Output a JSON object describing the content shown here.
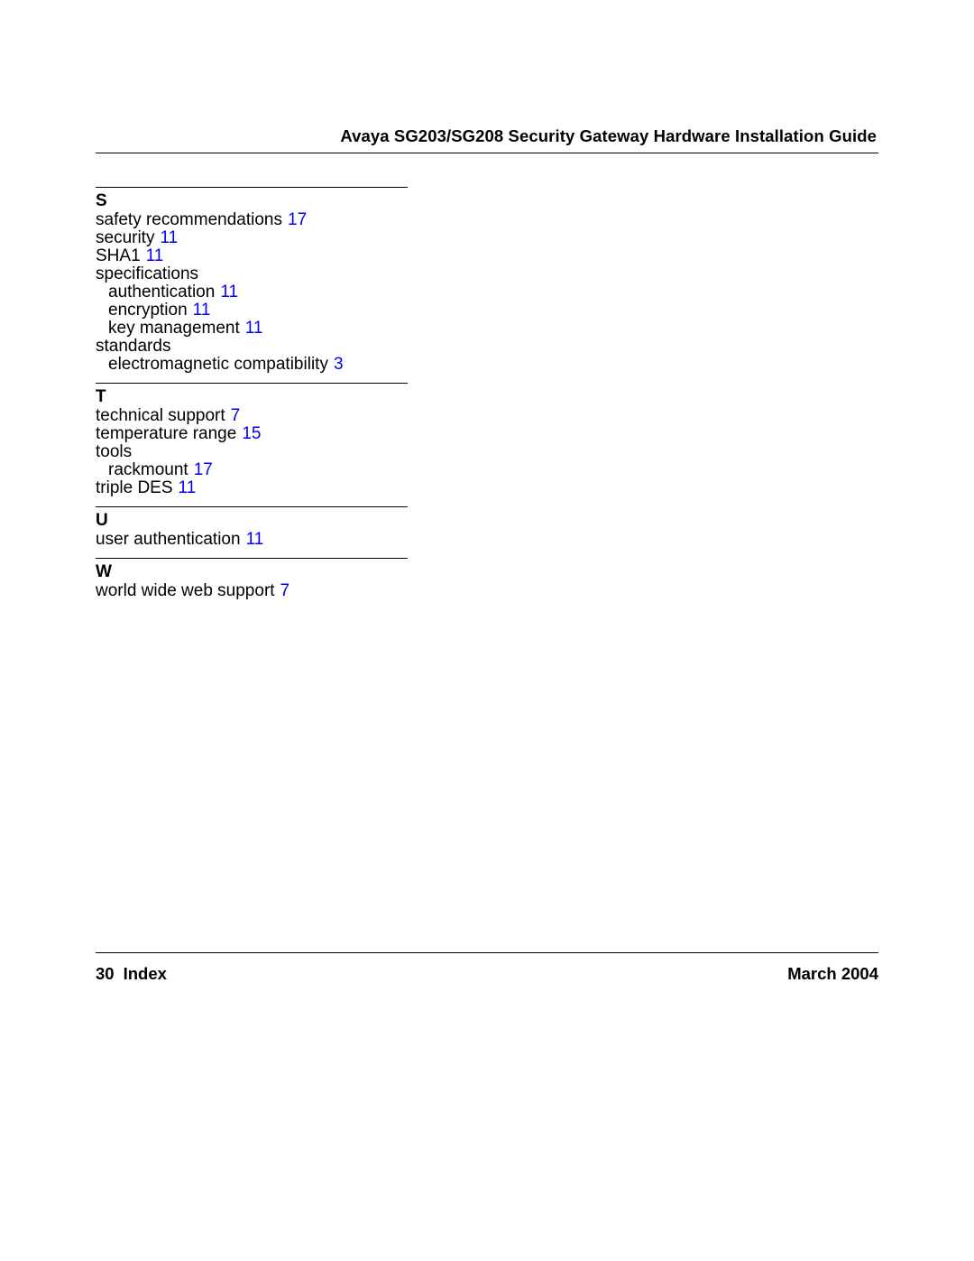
{
  "header": {
    "title": "Avaya SG203/SG208 Security Gateway Hardware Installation Guide"
  },
  "sections": {
    "S": {
      "letter": "S",
      "entries": {
        "safety_recommendations": {
          "label": "safety recommendations",
          "page": "17"
        },
        "security": {
          "label": "security",
          "page": "11"
        },
        "sha1": {
          "label": "SHA1",
          "page": "11"
        },
        "specifications": {
          "label": "specifications"
        },
        "spec_authentication": {
          "label": "authentication",
          "page": "11"
        },
        "spec_encryption": {
          "label": "encryption",
          "page": "11"
        },
        "spec_key_management": {
          "label": "key management",
          "page": "11"
        },
        "standards": {
          "label": "standards"
        },
        "std_emc": {
          "label": "electromagnetic compatibility",
          "page": "3"
        }
      }
    },
    "T": {
      "letter": "T",
      "entries": {
        "technical_support": {
          "label": "technical support",
          "page": "7"
        },
        "temperature_range": {
          "label": "temperature range",
          "page": "15"
        },
        "tools": {
          "label": "tools"
        },
        "tools_rackmount": {
          "label": "rackmount",
          "page": "17"
        },
        "triple_des": {
          "label": "triple DES",
          "page": "11"
        }
      }
    },
    "U": {
      "letter": "U",
      "entries": {
        "user_authentication": {
          "label": "user authentication",
          "page": "11"
        }
      }
    },
    "W": {
      "letter": "W",
      "entries": {
        "www_support": {
          "label": "world wide web support",
          "page": "7"
        }
      }
    }
  },
  "footer": {
    "page_number": "30",
    "section_name": "Index",
    "date": "March 2004"
  }
}
